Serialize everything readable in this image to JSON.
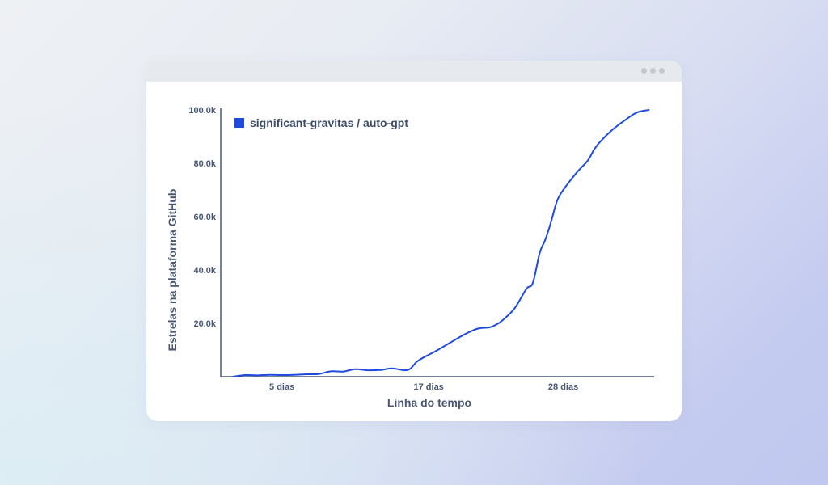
{
  "window": {
    "controls": [
      "dot",
      "dot",
      "dot"
    ]
  },
  "chart_data": {
    "type": "line",
    "xlabel": "Linha do tempo",
    "ylabel": "Estrelas na plataforma GitHub",
    "x_ticks": [
      {
        "label": "5 dias",
        "value": 5
      },
      {
        "label": "17 dias",
        "value": 17
      },
      {
        "label": "28 dias",
        "value": 28
      }
    ],
    "y_ticks": [
      {
        "label": "20.0k",
        "value": 20000
      },
      {
        "label": "40.0k",
        "value": 40000
      },
      {
        "label": "60.0k",
        "value": 60000
      },
      {
        "label": "80.0k",
        "value": 80000
      },
      {
        "label": "100.0k",
        "value": 100000
      }
    ],
    "xlim": [
      0,
      35.3
    ],
    "ylim": [
      0,
      100000
    ],
    "grid": false,
    "legend_position": "top-left",
    "series": [
      {
        "name": "significant-gravitas / auto-gpt",
        "color": "#1f4ae0",
        "x": [
          1,
          2,
          3,
          4,
          5,
          6,
          7,
          8,
          9,
          10,
          11,
          12,
          13,
          14,
          15,
          15.5,
          16,
          16.5,
          17,
          17.5,
          18,
          19,
          20,
          21,
          22,
          22.5,
          23,
          24,
          25,
          25.5,
          26,
          26.2,
          26.5,
          26.8,
          27,
          27.5,
          28,
          29,
          30,
          30.5,
          31,
          32,
          33,
          34,
          35
        ],
        "values": [
          0,
          600,
          500,
          700,
          600,
          700,
          900,
          1000,
          2000,
          1900,
          2800,
          2400,
          2500,
          3100,
          2400,
          3000,
          5500,
          7000,
          8200,
          9400,
          10700,
          13400,
          16000,
          18000,
          18500,
          19500,
          21000,
          25500,
          33000,
          35000,
          45000,
          48000,
          51000,
          55000,
          58000,
          66000,
          70000,
          76000,
          81000,
          85000,
          88000,
          92500,
          96000,
          99000,
          100000
        ]
      }
    ]
  }
}
